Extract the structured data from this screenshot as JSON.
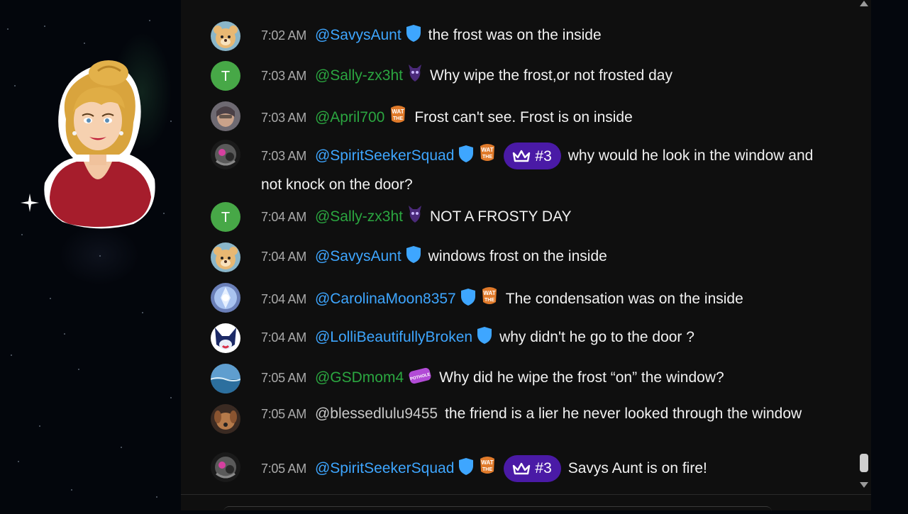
{
  "messages": [
    {
      "time": "7:02 AM",
      "author": "@SavysAunt",
      "author_color": "#3ea6ff",
      "avatar": "bear-avatar",
      "badges": [
        "moderator-shield-icon"
      ],
      "text": "the frost was on the inside"
    },
    {
      "time": "7:03 AM",
      "author": "@Sally-zx3ht",
      "author_color": "#2ba640",
      "avatar": "letter-avatar",
      "avatar_letter": "T",
      "badges": [
        "member-creature-badge-icon"
      ],
      "text": "Why wipe the frost,or not frosted day"
    },
    {
      "time": "7:03 AM",
      "author": "@April700",
      "author_color": "#2ba640",
      "avatar": "photo-avatar",
      "badges": [
        "member-wat-badge-icon"
      ],
      "text": "Frost can't see. Frost is on inside"
    },
    {
      "time": "7:03 AM",
      "author": "@SpiritSeekerSquad",
      "author_color": "#3ea6ff",
      "avatar": "spirit-avatar",
      "badges": [
        "moderator-shield-icon",
        "member-wat-badge-icon"
      ],
      "rank": "#3",
      "text": "why would he look in the window and not knock on the door?"
    },
    {
      "time": "7:04 AM",
      "author": "@Sally-zx3ht",
      "author_color": "#2ba640",
      "avatar": "letter-avatar",
      "avatar_letter": "T",
      "badges": [
        "member-creature-badge-icon"
      ],
      "text": "NOT A FROSTY DAY"
    },
    {
      "time": "7:04 AM",
      "author": "@SavysAunt",
      "author_color": "#3ea6ff",
      "avatar": "bear-avatar",
      "badges": [
        "moderator-shield-icon"
      ],
      "text": "windows frost on the inside"
    },
    {
      "time": "7:04 AM",
      "author": "@CarolinaMoon8357",
      "author_color": "#3ea6ff",
      "avatar": "crystal-avatar",
      "badges": [
        "moderator-shield-icon",
        "member-wat-badge-icon"
      ],
      "text": "The condensation was on the inside"
    },
    {
      "time": "7:04 AM",
      "author": "@LolliBeautifullyBroken",
      "author_color": "#3ea6ff",
      "avatar": "wolf-avatar",
      "badges": [
        "moderator-shield-icon"
      ],
      "text": "why didn't he go to the door ?"
    },
    {
      "time": "7:05 AM",
      "author": "@GSDmom4",
      "author_color": "#2ba640",
      "avatar": "sea-avatar",
      "badges": [
        "member-pothole-badge-icon"
      ],
      "text": "Why did he wipe the frost “on” the window?"
    },
    {
      "time": "7:05 AM",
      "author": "@blessedlulu9455",
      "author_color": "#c8c8c8",
      "avatar": "dog-avatar",
      "badges": [],
      "text": "the friend is a lier he never looked through the window"
    },
    {
      "time": "7:05 AM",
      "author": "@SpiritSeekerSquad",
      "author_color": "#3ea6ff",
      "avatar": "spirit-avatar",
      "badges": [
        "moderator-shield-icon",
        "member-wat-badge-icon"
      ],
      "rank": "#3",
      "text": "Savys Aunt is on fire!"
    }
  ],
  "badge_labels": {
    "wat": "WAT THE",
    "pothole": "I'M A POTHOLE"
  },
  "colors": {
    "panel_bg": "#0f0f0f",
    "moderator": "#3ea6ff",
    "member": "#2ba640",
    "rank_chip": "#4a1aa6"
  }
}
